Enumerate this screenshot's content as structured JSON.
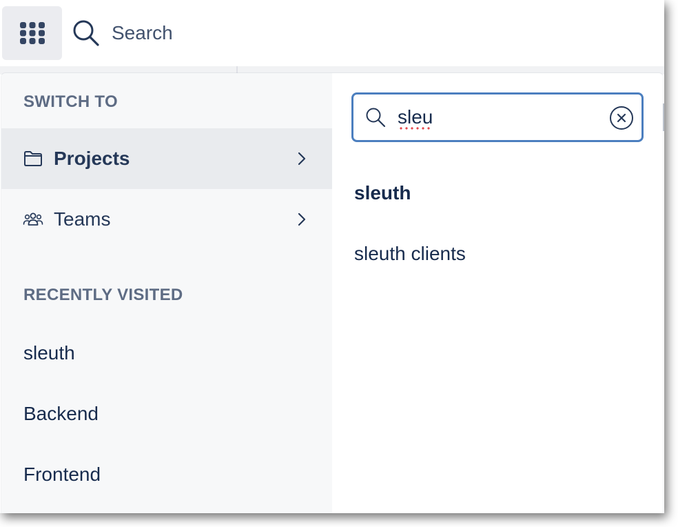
{
  "topbar": {
    "apps_icon": "grid-icon",
    "search_icon": "search-icon",
    "search_label": "Search"
  },
  "switcher": {
    "switch_heading": "SWITCH TO",
    "nav": [
      {
        "label": "Projects",
        "icon": "folder-icon",
        "active": true
      },
      {
        "label": "Teams",
        "icon": "people-icon",
        "active": false
      }
    ],
    "recent_heading": "RECENTLY VISITED",
    "recent": [
      "sleuth",
      "Backend",
      "Frontend"
    ]
  },
  "search": {
    "value": "sleu",
    "results": [
      "sleuth",
      "sleuth clients"
    ]
  },
  "colors": {
    "input_border": "#4c7fbf",
    "active_row": "#e9ebee",
    "left_pane": "#f7f8f9",
    "heading": "#5e6c84"
  }
}
